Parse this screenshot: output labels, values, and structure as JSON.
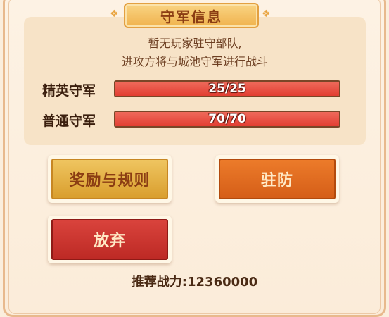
{
  "panel": {
    "title": "守军信息",
    "desc_line1": "暂无玩家驻守部队,",
    "desc_line2": "进攻方将与城池守军进行战斗"
  },
  "troops": [
    {
      "label": "精英守军",
      "value_text": "25/25",
      "fill": 1.0
    },
    {
      "label": "普通守军",
      "value_text": "70/70",
      "fill": 1.0
    }
  ],
  "buttons": {
    "rewards_rules": "奖励与规则",
    "garrison": "驻防",
    "abandon": "放弃"
  },
  "recommended_power": "推荐战力:12360000",
  "colors": {
    "bar_fill": "#e23e32",
    "gold_button": "#e2aa3f",
    "orange_button": "#dd6a1f",
    "red_button": "#c7332d"
  }
}
